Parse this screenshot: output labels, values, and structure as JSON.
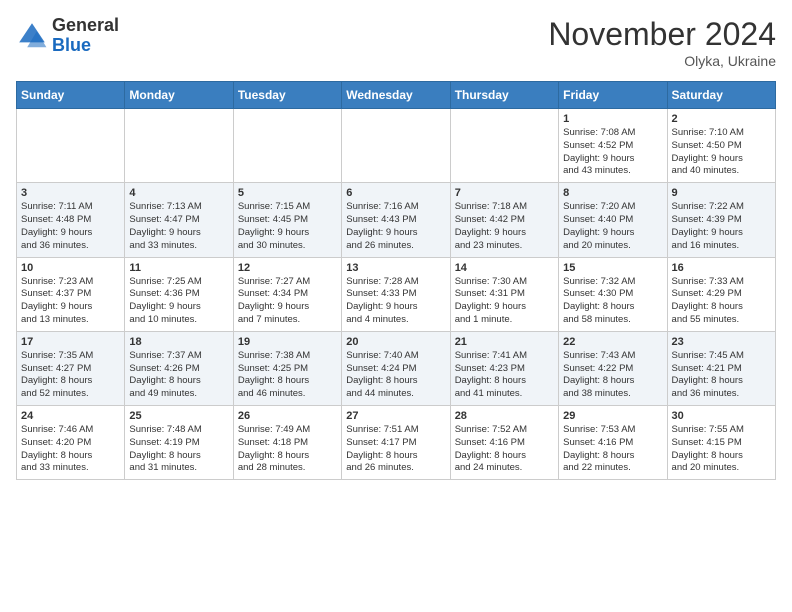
{
  "header": {
    "logo_line1": "General",
    "logo_line2": "Blue",
    "month": "November 2024",
    "location": "Olyka, Ukraine"
  },
  "weekdays": [
    "Sunday",
    "Monday",
    "Tuesday",
    "Wednesday",
    "Thursday",
    "Friday",
    "Saturday"
  ],
  "weeks": [
    [
      {
        "day": "",
        "info": ""
      },
      {
        "day": "",
        "info": ""
      },
      {
        "day": "",
        "info": ""
      },
      {
        "day": "",
        "info": ""
      },
      {
        "day": "",
        "info": ""
      },
      {
        "day": "1",
        "info": "Sunrise: 7:08 AM\nSunset: 4:52 PM\nDaylight: 9 hours\nand 43 minutes."
      },
      {
        "day": "2",
        "info": "Sunrise: 7:10 AM\nSunset: 4:50 PM\nDaylight: 9 hours\nand 40 minutes."
      }
    ],
    [
      {
        "day": "3",
        "info": "Sunrise: 7:11 AM\nSunset: 4:48 PM\nDaylight: 9 hours\nand 36 minutes."
      },
      {
        "day": "4",
        "info": "Sunrise: 7:13 AM\nSunset: 4:47 PM\nDaylight: 9 hours\nand 33 minutes."
      },
      {
        "day": "5",
        "info": "Sunrise: 7:15 AM\nSunset: 4:45 PM\nDaylight: 9 hours\nand 30 minutes."
      },
      {
        "day": "6",
        "info": "Sunrise: 7:16 AM\nSunset: 4:43 PM\nDaylight: 9 hours\nand 26 minutes."
      },
      {
        "day": "7",
        "info": "Sunrise: 7:18 AM\nSunset: 4:42 PM\nDaylight: 9 hours\nand 23 minutes."
      },
      {
        "day": "8",
        "info": "Sunrise: 7:20 AM\nSunset: 4:40 PM\nDaylight: 9 hours\nand 20 minutes."
      },
      {
        "day": "9",
        "info": "Sunrise: 7:22 AM\nSunset: 4:39 PM\nDaylight: 9 hours\nand 16 minutes."
      }
    ],
    [
      {
        "day": "10",
        "info": "Sunrise: 7:23 AM\nSunset: 4:37 PM\nDaylight: 9 hours\nand 13 minutes."
      },
      {
        "day": "11",
        "info": "Sunrise: 7:25 AM\nSunset: 4:36 PM\nDaylight: 9 hours\nand 10 minutes."
      },
      {
        "day": "12",
        "info": "Sunrise: 7:27 AM\nSunset: 4:34 PM\nDaylight: 9 hours\nand 7 minutes."
      },
      {
        "day": "13",
        "info": "Sunrise: 7:28 AM\nSunset: 4:33 PM\nDaylight: 9 hours\nand 4 minutes."
      },
      {
        "day": "14",
        "info": "Sunrise: 7:30 AM\nSunset: 4:31 PM\nDaylight: 9 hours\nand 1 minute."
      },
      {
        "day": "15",
        "info": "Sunrise: 7:32 AM\nSunset: 4:30 PM\nDaylight: 8 hours\nand 58 minutes."
      },
      {
        "day": "16",
        "info": "Sunrise: 7:33 AM\nSunset: 4:29 PM\nDaylight: 8 hours\nand 55 minutes."
      }
    ],
    [
      {
        "day": "17",
        "info": "Sunrise: 7:35 AM\nSunset: 4:27 PM\nDaylight: 8 hours\nand 52 minutes."
      },
      {
        "day": "18",
        "info": "Sunrise: 7:37 AM\nSunset: 4:26 PM\nDaylight: 8 hours\nand 49 minutes."
      },
      {
        "day": "19",
        "info": "Sunrise: 7:38 AM\nSunset: 4:25 PM\nDaylight: 8 hours\nand 46 minutes."
      },
      {
        "day": "20",
        "info": "Sunrise: 7:40 AM\nSunset: 4:24 PM\nDaylight: 8 hours\nand 44 minutes."
      },
      {
        "day": "21",
        "info": "Sunrise: 7:41 AM\nSunset: 4:23 PM\nDaylight: 8 hours\nand 41 minutes."
      },
      {
        "day": "22",
        "info": "Sunrise: 7:43 AM\nSunset: 4:22 PM\nDaylight: 8 hours\nand 38 minutes."
      },
      {
        "day": "23",
        "info": "Sunrise: 7:45 AM\nSunset: 4:21 PM\nDaylight: 8 hours\nand 36 minutes."
      }
    ],
    [
      {
        "day": "24",
        "info": "Sunrise: 7:46 AM\nSunset: 4:20 PM\nDaylight: 8 hours\nand 33 minutes."
      },
      {
        "day": "25",
        "info": "Sunrise: 7:48 AM\nSunset: 4:19 PM\nDaylight: 8 hours\nand 31 minutes."
      },
      {
        "day": "26",
        "info": "Sunrise: 7:49 AM\nSunset: 4:18 PM\nDaylight: 8 hours\nand 28 minutes."
      },
      {
        "day": "27",
        "info": "Sunrise: 7:51 AM\nSunset: 4:17 PM\nDaylight: 8 hours\nand 26 minutes."
      },
      {
        "day": "28",
        "info": "Sunrise: 7:52 AM\nSunset: 4:16 PM\nDaylight: 8 hours\nand 24 minutes."
      },
      {
        "day": "29",
        "info": "Sunrise: 7:53 AM\nSunset: 4:16 PM\nDaylight: 8 hours\nand 22 minutes."
      },
      {
        "day": "30",
        "info": "Sunrise: 7:55 AM\nSunset: 4:15 PM\nDaylight: 8 hours\nand 20 minutes."
      }
    ]
  ]
}
